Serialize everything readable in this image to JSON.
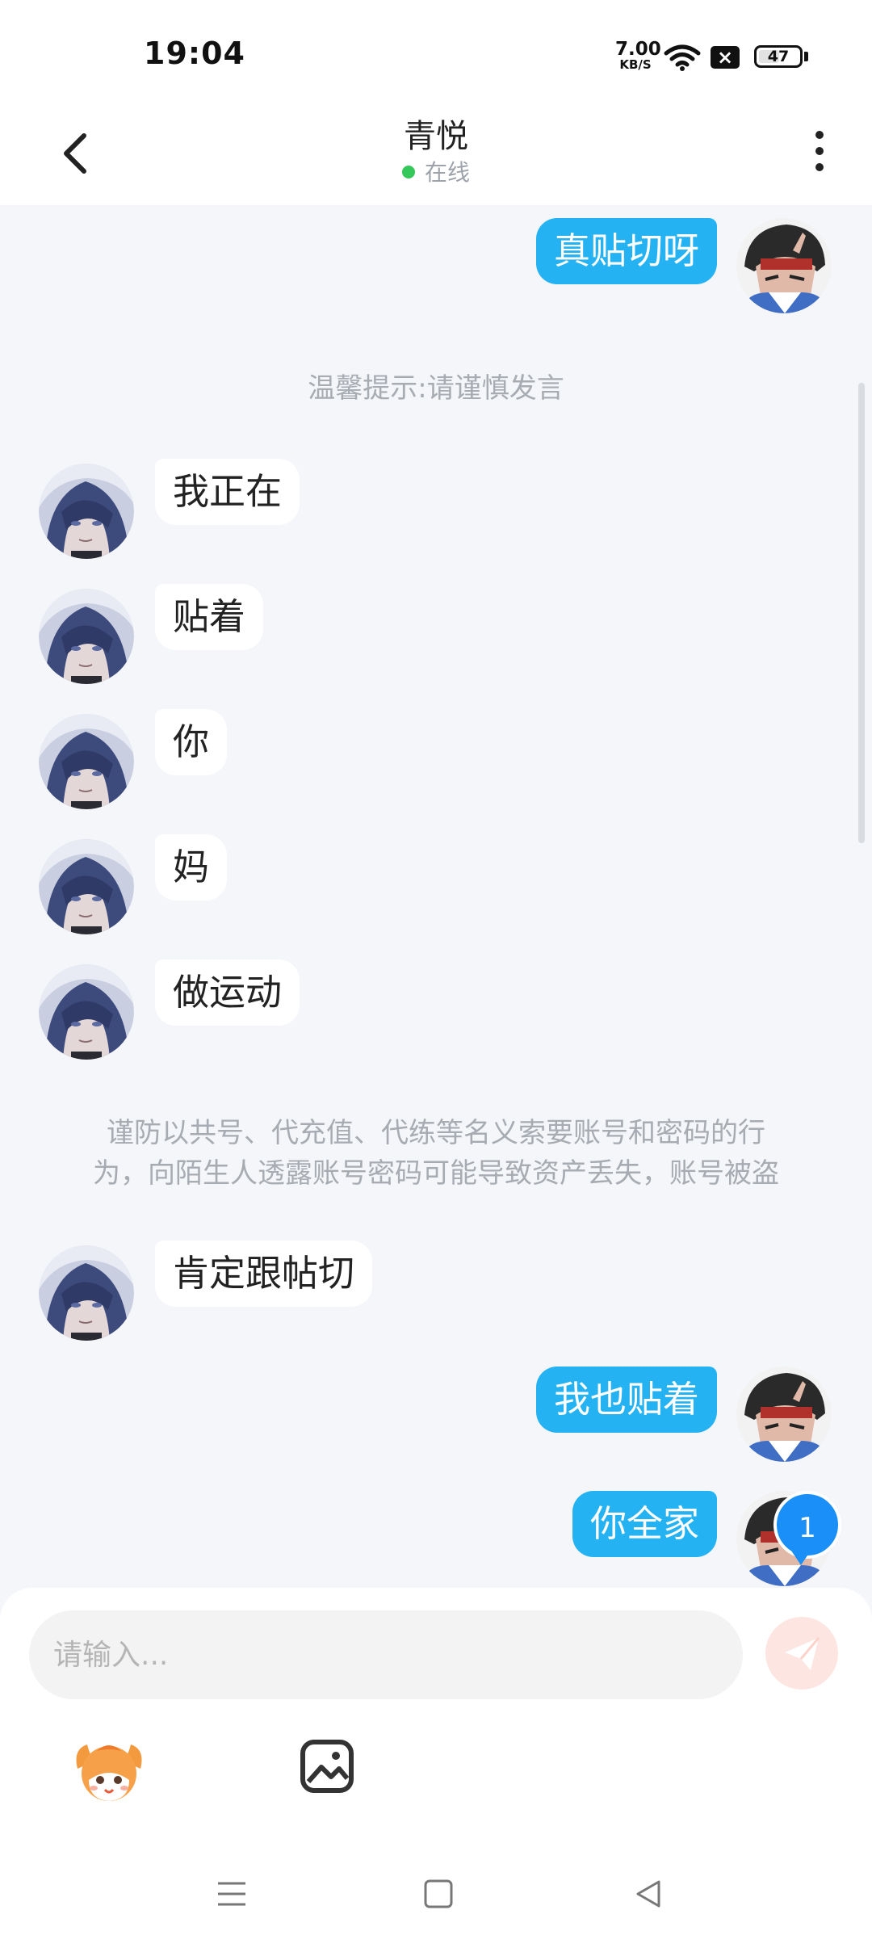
{
  "status_bar": {
    "time": "19:04",
    "net_speed_value": "7.00",
    "net_speed_unit": "KB/S",
    "battery_level": "47"
  },
  "header": {
    "title": "青悦",
    "status": "在线",
    "back_icon": "back-arrow-icon",
    "more_icon": "more-vertical-icon"
  },
  "messages": [
    {
      "type": "outgoing",
      "text": "真贴切呀"
    },
    {
      "type": "system",
      "text": "温馨提示:请谨慎发言"
    },
    {
      "type": "incoming",
      "text": "我正在"
    },
    {
      "type": "incoming",
      "text": "贴着"
    },
    {
      "type": "incoming",
      "text": "你"
    },
    {
      "type": "incoming",
      "text": "妈"
    },
    {
      "type": "incoming",
      "text": "做运动"
    },
    {
      "type": "system",
      "line1": "谨防以共号、代充值、代练等名义索要账号和密码的行",
      "line2": "为，向陌生人透露账号密码可能导致资产丢失，账号被盗"
    },
    {
      "type": "incoming",
      "text": "肯定跟帖切"
    },
    {
      "type": "outgoing",
      "text": "我也贴着"
    },
    {
      "type": "outgoing",
      "text": "你全家"
    }
  ],
  "unread_badge": "1",
  "input": {
    "placeholder": "请输入...",
    "value": ""
  },
  "toolbar": {
    "emoji_icon": "sticker-mascot-icon",
    "image_icon": "image-icon",
    "send_icon": "send-icon"
  },
  "nav": {
    "menu_icon": "menu-icon",
    "home_icon": "home-square-icon",
    "back_icon": "back-triangle-icon"
  },
  "colors": {
    "outgoing_bubble": "#25b2f2",
    "incoming_bubble": "#ffffff",
    "background": "#f4f6f9",
    "online_dot": "#34c759",
    "badge": "#1a8ff7",
    "send_button": "#fde5e1"
  }
}
